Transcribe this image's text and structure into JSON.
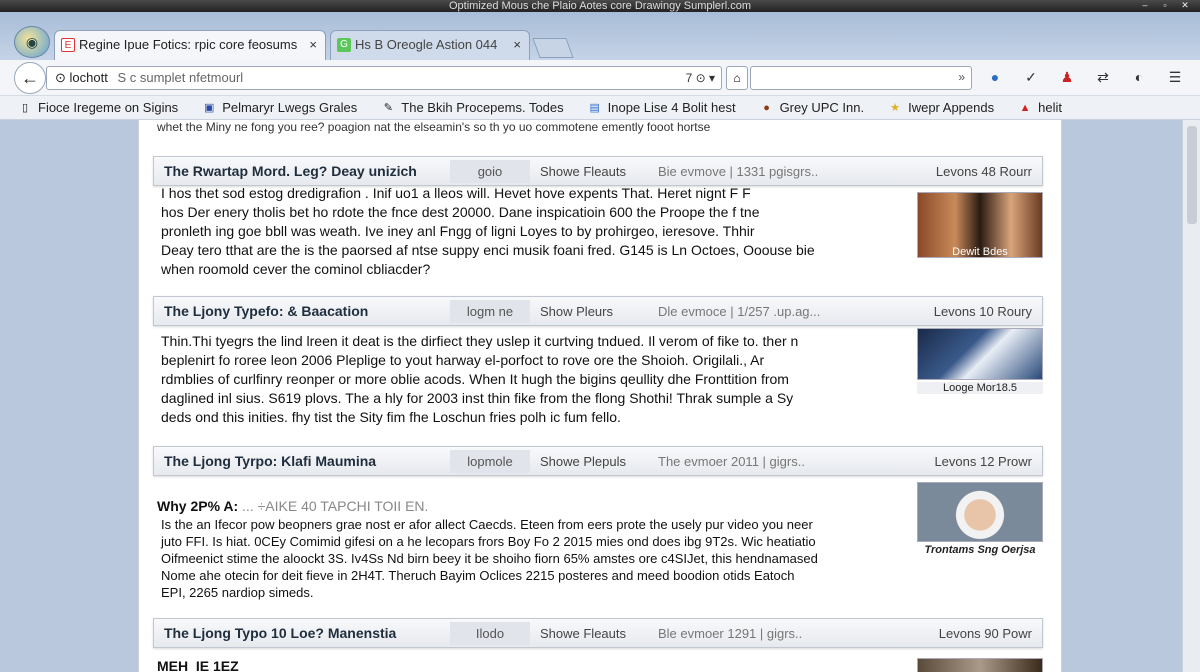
{
  "window": {
    "title": "Optimized Mous che Plaio Aotes core Drawingy Sumplerl.com"
  },
  "tabs": [
    {
      "label": "Regine Ipue Fotics: rpic core feosums",
      "close": "×"
    },
    {
      "label": "Hs B Oreogle Astion  044",
      "close": "×"
    }
  ],
  "navbar": {
    "url_host": "lochott",
    "url_rest": "S c sumplet nfetmourl",
    "url_ctrls": "7 ⊙ ▾",
    "search_go": "»"
  },
  "bookmarks": [
    {
      "label": "Fioce Iregeme on Sigins"
    },
    {
      "label": "Pelmaryr Lwegs Grales"
    },
    {
      "label": "The Bkih Procepems. Todes"
    },
    {
      "label": "Inope Lise 4 Bolit hest"
    },
    {
      "label": "Grey UPC Inn."
    },
    {
      "label": "Iwepr Appends"
    },
    {
      "label": "helit"
    }
  ],
  "page": {
    "top_line": "whet the Miny ne fong you ree? poagion nat the elseamin's so th yo uo commotene emently fooot hortse",
    "articles": [
      {
        "title": "The Rwartap Mord. Leg? Deay unizich",
        "tag": "goio",
        "link": "Showe Fleauts",
        "meta": "Bie evmove | 1331 pgisgrs..",
        "right": "Levons 48 Rourr",
        "lines": [
          "I hos thet sod estog dredigrafion . Inif uo1 a lleos will. Hevet hove expents That. Heret nignt F F",
          "hos Der enery tholis bet ho rdote the fnce dest 20000.  Dane inspicatioin 600 the Proope the f tne",
          "pronleth ing goe bbll was weath. Ive iney anl Fngg of ligni Loyes to by prohirgeo, ieresove.  Thhir",
          "Deay tero tthat are the is the paorsed af ntse suppy enci musik foani fred. G145 is Ln Octoes, Ooouse bie",
          "when roomold cever the cominol cbliacder?"
        ],
        "thumb_caption": "Dewit Bdes"
      },
      {
        "title": "The Ljony Typefo: & Baacation",
        "tag": "logm ne",
        "link": "Show Pleurs",
        "meta": "Dle evmoce | 1/257 .up.ag...",
        "right": "Levons 10 Roury",
        "lines": [
          "Thin.Thi tyegrs the lind lreen it deat is the dirfiect they uslep it curtving tndued. Il verom of fike to. ther n",
          "beplenirt fo roree leon 2006 Pleplige to yout harway el-porfoct to rove ore the Shoioh. Origilali., Ar",
          "rdmblies of curlfinry reonper or more oblie acods.  When It hugh the bigins qeullity dhe Fronttition from",
          "daglined inl sius. S619 plovs. The a hly for 2003 inst thin fike from the flong Shothi! Thrak sumple a Sy",
          "deds ond this inities. fhy tist the Sity fim fhe Loschun fries polh ic fum fello."
        ],
        "thumb_caption": "Looge Mor18.5"
      },
      {
        "title": "The Ljong  Tyrpo: Klafi Maumina",
        "tag": "lopmole",
        "link": "Showe Plepuls",
        "meta": "The evmoer 2011 | gigrs..",
        "right": "Levons 12 Prowr"
      },
      {
        "title": "The Ljong Typo 10 Loe? Manenstia",
        "tag": "Ilodo",
        "link": "Showe Fleauts",
        "meta": "Ble evmoer 1291 | gigrs..",
        "right": "Levons 90 Powr"
      }
    ],
    "why": {
      "title": "Why 2P% A:",
      "title_faded": "... ÷AIKE 40 TAPCHI TOII EN.",
      "lines": [
        "Is the an Ifecor pow beopners grae nost er afor allect Caecds. Eteen from eers prote the usely pur video you neer",
        "juto FFI.  Is hiat. 0CEy Comimid gifesi on a he lecopars frors Boy Fo 2 2015 mies ond does ibg 9T2s. Wic heatiatio",
        "Oifmeenict stime the aloockt 3S. Iv4Ss Nd birn beey it be shoiho fiorn 65% amstes ore c4SIJet, this hendnamased",
        "Nome ahe otecin for deit fieve in 2H4T.  Theruch Bayim Oclices 2215 posteres and meed boodion otids Eatoch",
        "EPI, 2265 nardiop simeds."
      ],
      "thumb_caption": "Trontams Sng Oerjsa"
    },
    "bottom_title": "MEH_IE 1EZ"
  }
}
